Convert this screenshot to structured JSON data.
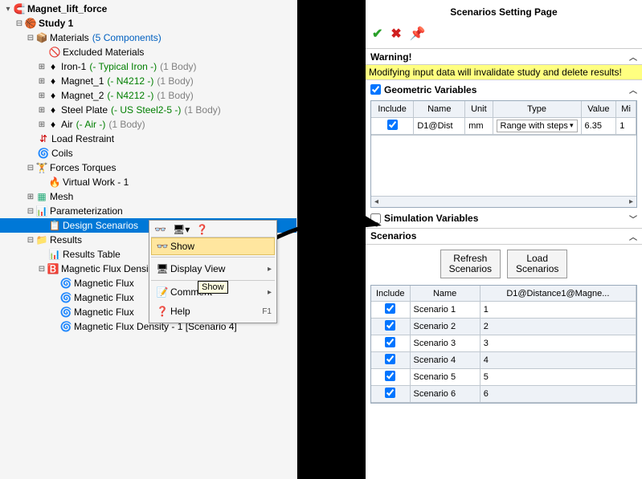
{
  "tree": {
    "root": "Magnet_lift_force",
    "study": "Study 1",
    "materials_label": "Materials",
    "materials_count": "(5 Components)",
    "excluded": "Excluded Materials",
    "iron_name": "Iron-1",
    "iron_mat": "(- Typical Iron -)",
    "iron_body": "(1 Body)",
    "mag1_name": "Magnet_1",
    "mag1_mat": "(- N4212 -)",
    "mag1_body": "(1 Body)",
    "mag2_name": "Magnet_2",
    "mag2_mat": "(- N4212 -)",
    "mag2_body": "(1 Body)",
    "steel_name": "Steel Plate",
    "steel_mat": "(- US Steel2-5 -)",
    "steel_body": "(1 Body)",
    "air_name": "Air",
    "air_mat": "(- Air -)",
    "air_body": "(1 Body)",
    "load_restraint": "Load Restraint",
    "coils": "Coils",
    "forces": "Forces Torques",
    "vw1": "Virtual Work - 1",
    "mesh": "Mesh",
    "param": "Parameterization",
    "design_scen": "Design Scenarios",
    "results": "Results",
    "results_table": "Results Table",
    "mfd": "Magnetic Flux Density",
    "mfx": "Magnetic Flux",
    "mfd1_s4": "Magnetic Flux Density - 1   [Scenario 4]"
  },
  "ctx": {
    "show": "Show",
    "display_view": "Display View",
    "comment": "Comment",
    "help": "Help",
    "help_key": "F1",
    "tooltip": "Show"
  },
  "rp": {
    "title": "Scenarios Setting Page",
    "warning_head": "Warning!",
    "warning_text": "Modifying input data will invalidate study and delete results!",
    "geo_head": "Geometric Variables",
    "sim_head": "Simulation Variables",
    "scen_head": "Scenarios",
    "refresh": "Refresh\nScenarios",
    "load": "Load\nScenarios"
  },
  "geo_cols": [
    "Include",
    "Name",
    "Unit",
    "Type",
    "Value",
    "Mi"
  ],
  "geo_row": {
    "name": "D1@Dist",
    "unit": "mm",
    "type": "Range with steps",
    "value": "6.35",
    "min": "1"
  },
  "scen_cols": [
    "Include",
    "Name",
    "D1@Distance1@Magne..."
  ],
  "scenarios": [
    {
      "name": "Scenario 1",
      "val": "1"
    },
    {
      "name": "Scenario 2",
      "val": "2"
    },
    {
      "name": "Scenario 3",
      "val": "3"
    },
    {
      "name": "Scenario 4",
      "val": "4"
    },
    {
      "name": "Scenario 5",
      "val": "5"
    },
    {
      "name": "Scenario 6",
      "val": "6"
    }
  ]
}
